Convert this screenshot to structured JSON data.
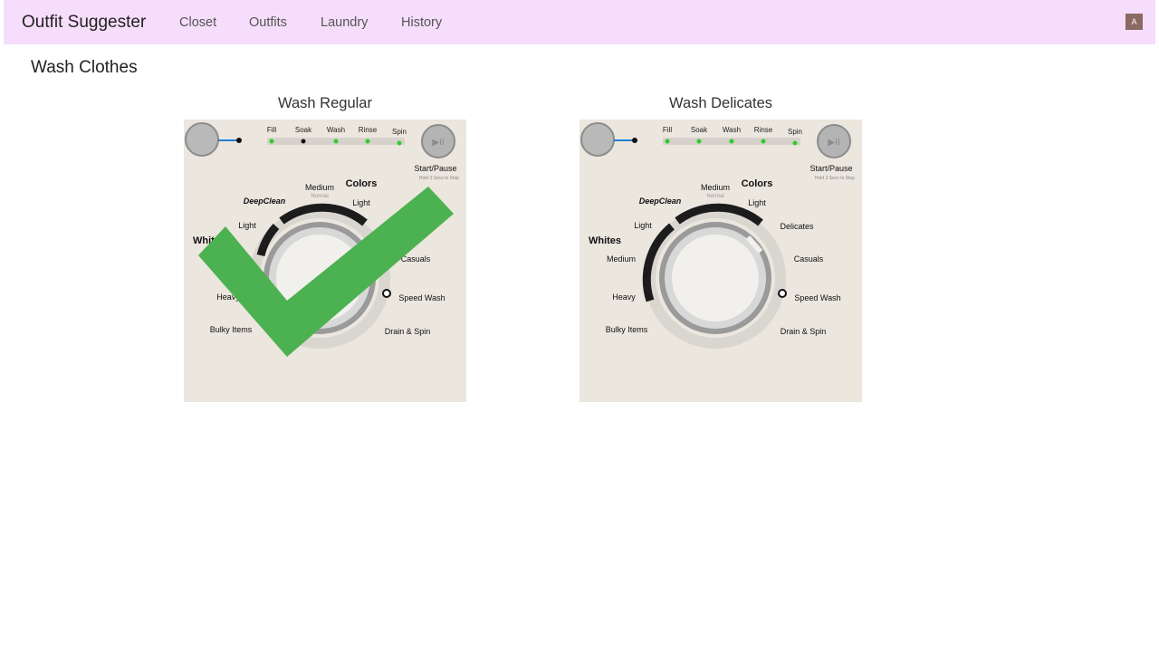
{
  "nav": {
    "brand": "Outfit Suggester",
    "links": [
      "Closet",
      "Outfits",
      "Laundry",
      "History"
    ],
    "avatar_initial": "A"
  },
  "page": {
    "title": "Wash Clothes"
  },
  "options": [
    {
      "title": "Wash Regular",
      "selected": true,
      "knob_setting": "Colors",
      "checkmark_color": "#4caf50"
    },
    {
      "title": "Wash Delicates",
      "selected": false,
      "knob_setting": "Delicates"
    }
  ],
  "panel_labels": {
    "stages": [
      "Fill",
      "Soak",
      "Wash",
      "Rinse",
      "Spin"
    ],
    "start_pause": "Start/Pause",
    "start_pause_hint": "Hold 3 Secs to Stop",
    "deepclean": "DeepClean",
    "medium_top": "Medium",
    "normal": "Normal",
    "colors": "Colors",
    "light_right": "Light",
    "light_left": "Light",
    "whites": "Whites",
    "medium_left": "Medium",
    "heavy": "Heavy",
    "bulky": "Bulky Items",
    "delicates": "Delicates",
    "casuals": "Casuals",
    "speed_wash": "Speed Wash",
    "drain_spin": "Drain & Spin"
  }
}
